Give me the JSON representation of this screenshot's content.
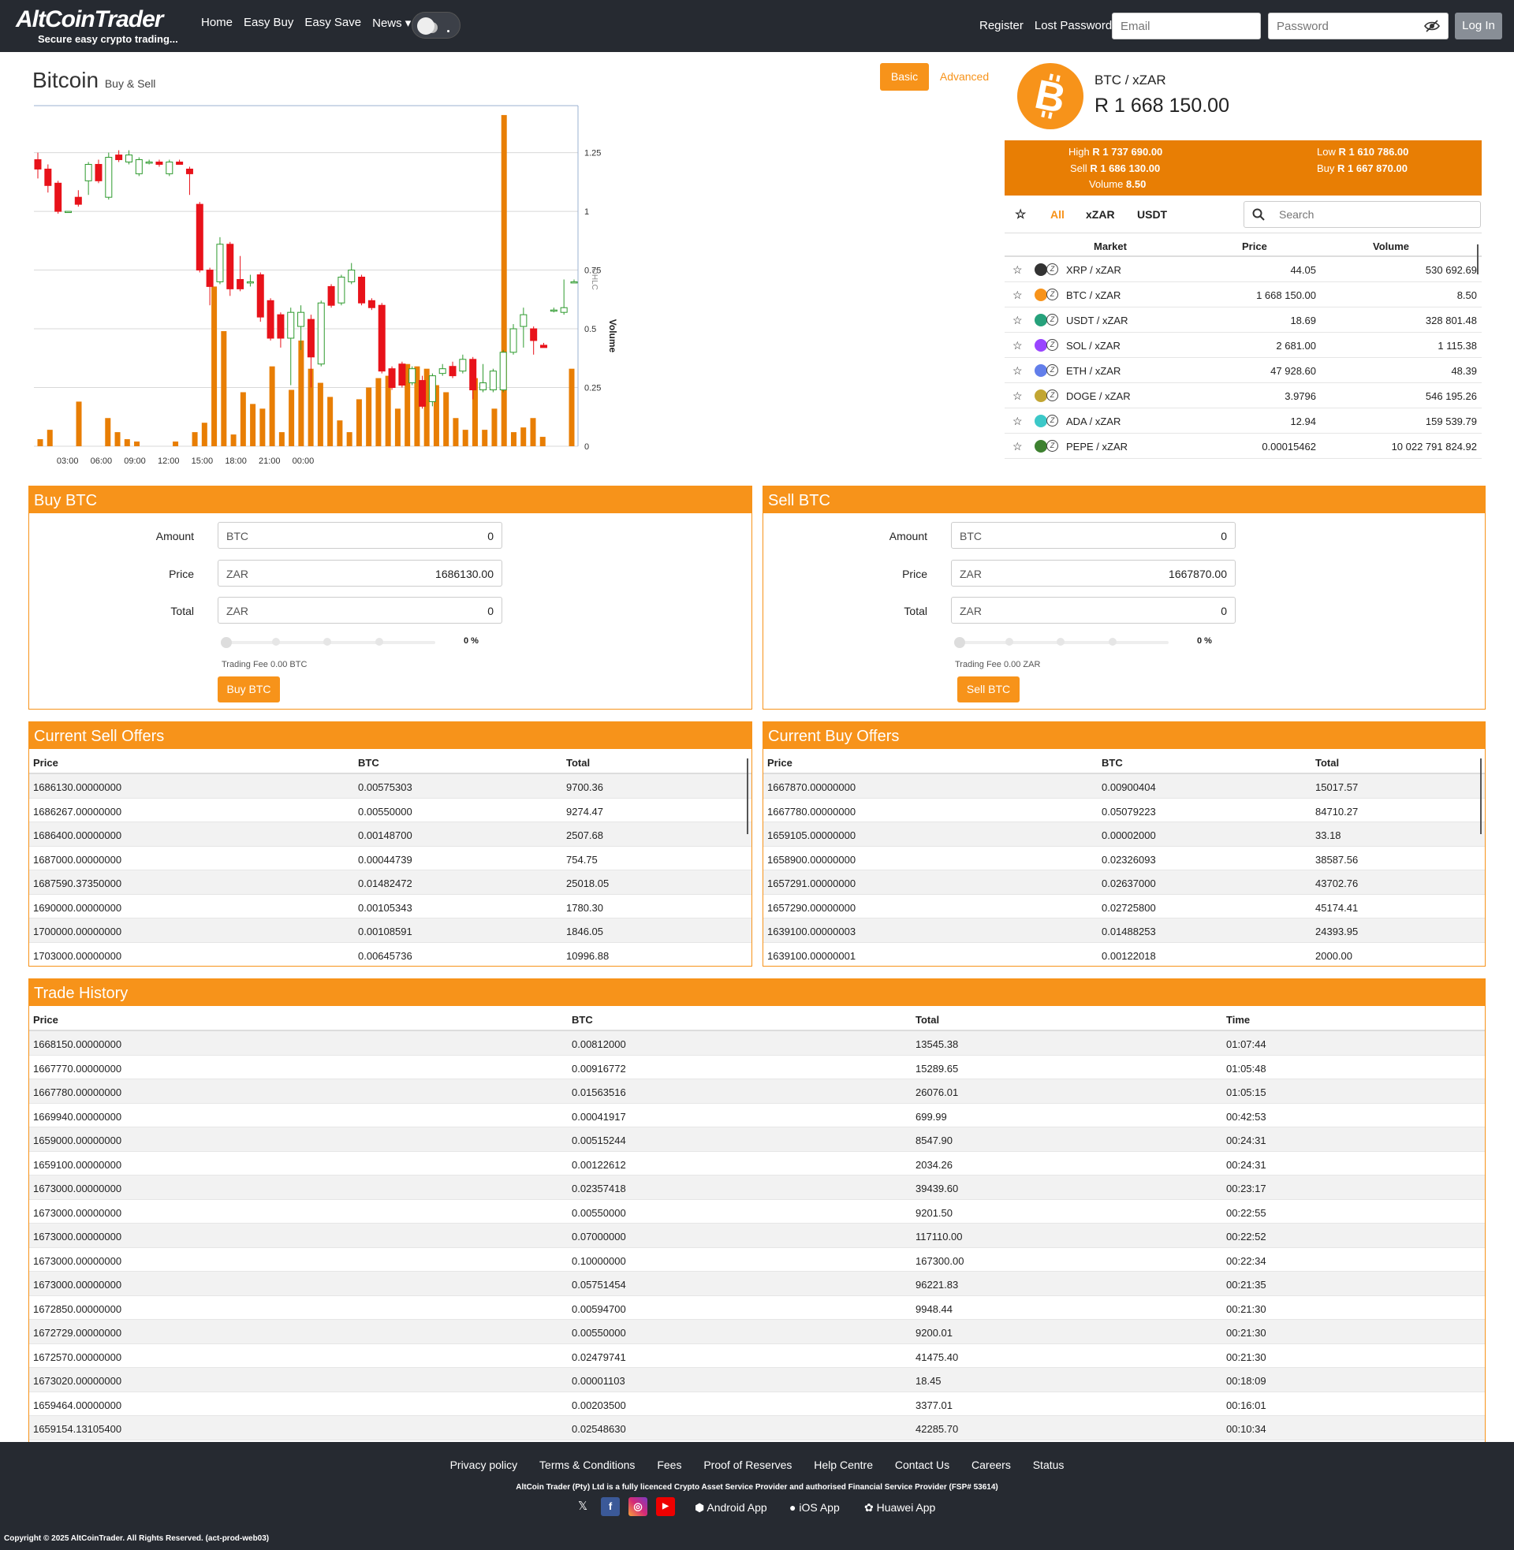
{
  "header": {
    "logo_text": "AltCoinTrader",
    "logo_tagline": "Secure easy crypto trading...",
    "nav": [
      "Home",
      "Easy Buy",
      "Easy Save",
      "News ▾"
    ],
    "register": "Register",
    "lost_password": "Lost Password",
    "email_placeholder": "Email",
    "password_placeholder": "Password",
    "login": "Log In"
  },
  "page": {
    "title": "Bitcoin",
    "subtitle": "Buy & Sell",
    "tab_basic": "Basic",
    "tab_advanced": "Advanced"
  },
  "ticker": {
    "pair": "BTC / xZAR",
    "price": "R 1 668 150.00",
    "high_label": "High",
    "high": "R 1 737 690.00",
    "low_label": "Low",
    "low": "R 1 610 786.00",
    "sell_label": "Sell",
    "sell": "R 1 686 130.00",
    "buy_label": "Buy",
    "buy": "R 1 667 870.00",
    "volume_label": "Volume",
    "volume": "8.50"
  },
  "markets": {
    "tabs": [
      "All",
      "xZAR",
      "USDT"
    ],
    "active_tab": "All",
    "search_placeholder": "Search",
    "headers": {
      "market": "Market",
      "price": "Price",
      "volume": "Volume"
    },
    "rows": [
      {
        "market": "XRP / xZAR",
        "price": "44.05",
        "volume": "530 692.69",
        "color": "#333333"
      },
      {
        "market": "BTC / xZAR",
        "price": "1 668 150.00",
        "volume": "8.50",
        "color": "#f7931a"
      },
      {
        "market": "USDT / xZAR",
        "price": "18.69",
        "volume": "328 801.48",
        "color": "#26a17b"
      },
      {
        "market": "SOL / xZAR",
        "price": "2 681.00",
        "volume": "1 115.38",
        "color": "#9945ff"
      },
      {
        "market": "ETH / xZAR",
        "price": "47 928.60",
        "volume": "48.39",
        "color": "#627eea"
      },
      {
        "market": "DOGE / xZAR",
        "price": "3.9796",
        "volume": "546 195.26",
        "color": "#c2a633"
      },
      {
        "market": "ADA / xZAR",
        "price": "12.94",
        "volume": "159 539.79",
        "color": "#3cc8c8"
      },
      {
        "market": "PEPE / xZAR",
        "price": "0.00015462",
        "volume": "10 022 791 824.92",
        "color": "#3d8130"
      }
    ]
  },
  "buy_form": {
    "title": "Buy BTC",
    "amount_label": "Amount",
    "amount_unit": "BTC",
    "amount": "0",
    "price_label": "Price",
    "price_unit": "ZAR",
    "price": "1686130.00",
    "total_label": "Total",
    "total_unit": "ZAR",
    "total": "0",
    "percent": "0 %",
    "fee": "Trading Fee 0.00 BTC",
    "button": "Buy BTC"
  },
  "sell_form": {
    "title": "Sell BTC",
    "amount_label": "Amount",
    "amount_unit": "BTC",
    "amount": "0",
    "price_label": "Price",
    "price_unit": "ZAR",
    "price": "1667870.00",
    "total_label": "Total",
    "total_unit": "ZAR",
    "total": "0",
    "percent": "0 %",
    "fee": "Trading Fee 0.00 ZAR",
    "button": "Sell BTC"
  },
  "sell_offers": {
    "title": "Current Sell Offers",
    "headers": [
      "Price",
      "BTC",
      "Total"
    ],
    "rows": [
      [
        "1686130.00000000",
        "0.00575303",
        "9700.36"
      ],
      [
        "1686267.00000000",
        "0.00550000",
        "9274.47"
      ],
      [
        "1686400.00000000",
        "0.00148700",
        "2507.68"
      ],
      [
        "1687000.00000000",
        "0.00044739",
        "754.75"
      ],
      [
        "1687590.37350000",
        "0.01482472",
        "25018.05"
      ],
      [
        "1690000.00000000",
        "0.00105343",
        "1780.30"
      ],
      [
        "1700000.00000000",
        "0.00108591",
        "1846.05"
      ],
      [
        "1703000.00000000",
        "0.00645736",
        "10996.88"
      ]
    ]
  },
  "buy_offers": {
    "title": "Current Buy Offers",
    "headers": [
      "Price",
      "BTC",
      "Total"
    ],
    "rows": [
      [
        "1667870.00000000",
        "0.00900404",
        "15017.57"
      ],
      [
        "1667780.00000000",
        "0.05079223",
        "84710.27"
      ],
      [
        "1659105.00000000",
        "0.00002000",
        "33.18"
      ],
      [
        "1658900.00000000",
        "0.02326093",
        "38587.56"
      ],
      [
        "1657291.00000000",
        "0.02637000",
        "43702.76"
      ],
      [
        "1657290.00000000",
        "0.02725800",
        "45174.41"
      ],
      [
        "1639100.00000003",
        "0.01488253",
        "24393.95"
      ],
      [
        "1639100.00000001",
        "0.00122018",
        "2000.00"
      ]
    ]
  },
  "trade_history": {
    "title": "Trade History",
    "headers": [
      "Price",
      "BTC",
      "Total",
      "Time"
    ],
    "rows": [
      [
        "1668150.00000000",
        "0.00812000",
        "13545.38",
        "01:07:44"
      ],
      [
        "1667770.00000000",
        "0.00916772",
        "15289.65",
        "01:05:48"
      ],
      [
        "1667780.00000000",
        "0.01563516",
        "26076.01",
        "01:05:15"
      ],
      [
        "1669940.00000000",
        "0.00041917",
        "699.99",
        "00:42:53"
      ],
      [
        "1659000.00000000",
        "0.00515244",
        "8547.90",
        "00:24:31"
      ],
      [
        "1659100.00000000",
        "0.00122612",
        "2034.26",
        "00:24:31"
      ],
      [
        "1673000.00000000",
        "0.02357418",
        "39439.60",
        "00:23:17"
      ],
      [
        "1673000.00000000",
        "0.00550000",
        "9201.50",
        "00:22:55"
      ],
      [
        "1673000.00000000",
        "0.07000000",
        "117110.00",
        "00:22:52"
      ],
      [
        "1673000.00000000",
        "0.10000000",
        "167300.00",
        "00:22:34"
      ],
      [
        "1673000.00000000",
        "0.05751454",
        "96221.83",
        "00:21:35"
      ],
      [
        "1672850.00000000",
        "0.00594700",
        "9948.44",
        "00:21:30"
      ],
      [
        "1672729.00000000",
        "0.00550000",
        "9200.01",
        "00:21:30"
      ],
      [
        "1672570.00000000",
        "0.02479741",
        "41475.40",
        "00:21:30"
      ],
      [
        "1673020.00000000",
        "0.00001103",
        "18.45",
        "00:18:09"
      ],
      [
        "1659464.00000000",
        "0.00203500",
        "3377.01",
        "00:16:01"
      ],
      [
        "1659154.13105400",
        "0.02548630",
        "42285.70",
        "00:10:34"
      ]
    ]
  },
  "footer": {
    "links": [
      "Privacy policy",
      "Terms & Conditions",
      "Fees",
      "Proof of Reserves",
      "Help Centre",
      "Contact Us",
      "Careers",
      "Status"
    ],
    "legal": "AltCoin Trader (Pty) Ltd is a fully licenced Crypto Asset Service Provider and authorised Financial Service Provider (FSP# 53614)",
    "apps": [
      "Android App",
      "iOS App",
      "Huawei App"
    ],
    "copyright": "Copyright © 2025 AltCoinTrader. All Rights Reserved. (act-prod-web03)"
  },
  "colors": {
    "accent": "#f7931a",
    "dark": "#262a31",
    "up": "#2e9a2e",
    "down": "#e8121a"
  },
  "chart_data": {
    "type": "candlestick",
    "x_ticks": [
      "03:00",
      "06:00",
      "09:00",
      "12:00",
      "15:00",
      "18:00",
      "21:00",
      "00:00"
    ],
    "y_axis_label": "Volume",
    "y_ticks": [
      "0",
      "0.25",
      "0.5",
      "0.75",
      "1",
      "1.25"
    ],
    "ylim": [
      0,
      1.45
    ],
    "ohlc_label": "OHLC",
    "hours": [
      0.5,
      1,
      2,
      3,
      4,
      5,
      6,
      7,
      8,
      9,
      10,
      11,
      12,
      13,
      14,
      15,
      16,
      17,
      18,
      19,
      20,
      21,
      22,
      23,
      24,
      25,
      26,
      27,
      28,
      29,
      30,
      31,
      32,
      33,
      34,
      35,
      36,
      37,
      38,
      39,
      40,
      41,
      42,
      43,
      44,
      45,
      46,
      47,
      48
    ],
    "volume": [
      0.03,
      0.07,
      0.0,
      0.0,
      0.19,
      0.0,
      0.0,
      0.12,
      0.06,
      0.03,
      0.02,
      0.0,
      0.0,
      0.0,
      0.02,
      0.0,
      0.06,
      0.1,
      0.68,
      0.49,
      0.05,
      0.23,
      0.18,
      0.16,
      0.34,
      0.06,
      0.24,
      0.45,
      0.33,
      0.27,
      0.21,
      0.11,
      0.06,
      0.2,
      0.25,
      0.29,
      0.3,
      0.16,
      0.35,
      0.34,
      0.33,
      0.26,
      0.23,
      0.12,
      0.07,
      0.29,
      0.07,
      0.16,
      1.41,
      0.06,
      0.08,
      0.12,
      0.04,
      0.0,
      0.0,
      0.33
    ],
    "candles": [
      {
        "o": 1.22,
        "c": 1.18,
        "h": 1.25,
        "l": 1.14
      },
      {
        "o": 1.18,
        "c": 1.11,
        "h": 1.2,
        "l": 1.08
      },
      {
        "o": 1.12,
        "c": 1.0,
        "h": 1.13,
        "l": 0.99
      },
      {
        "o": 1.0,
        "c": 1.0,
        "h": 1.0,
        "l": 1.0
      },
      {
        "o": 1.06,
        "c": 1.03,
        "h": 1.09,
        "l": 1.02
      },
      {
        "o": 1.13,
        "c": 1.2,
        "h": 1.21,
        "l": 1.07
      },
      {
        "o": 1.2,
        "c": 1.13,
        "h": 1.22,
        "l": 1.12
      },
      {
        "o": 1.06,
        "c": 1.23,
        "h": 1.25,
        "l": 1.05
      },
      {
        "o": 1.24,
        "c": 1.22,
        "h": 1.26,
        "l": 1.21
      },
      {
        "o": 1.21,
        "c": 1.24,
        "h": 1.26,
        "l": 1.2
      },
      {
        "o": 1.16,
        "c": 1.22,
        "h": 1.23,
        "l": 1.15
      },
      {
        "o": 1.21,
        "c": 1.21,
        "h": 1.22,
        "l": 1.2
      },
      {
        "o": 1.21,
        "c": 1.2,
        "h": 1.22,
        "l": 1.19
      },
      {
        "o": 1.16,
        "c": 1.21,
        "h": 1.22,
        "l": 1.15
      },
      {
        "o": 1.21,
        "c": 1.2,
        "h": 1.22,
        "l": 1.2
      },
      {
        "o": 1.18,
        "c": 1.16,
        "h": 1.19,
        "l": 1.07
      },
      {
        "o": 1.03,
        "c": 0.75,
        "h": 1.04,
        "l": 0.74
      },
      {
        "o": 0.75,
        "c": 0.68,
        "h": 0.76,
        "l": 0.6
      },
      {
        "o": 0.7,
        "c": 0.86,
        "h": 0.89,
        "l": 0.69
      },
      {
        "o": 0.86,
        "c": 0.67,
        "h": 0.87,
        "l": 0.64
      },
      {
        "o": 0.71,
        "c": 0.67,
        "h": 0.81,
        "l": 0.66
      },
      {
        "o": 0.7,
        "c": 0.7,
        "h": 0.73,
        "l": 0.68
      },
      {
        "o": 0.73,
        "c": 0.55,
        "h": 0.74,
        "l": 0.53
      },
      {
        "o": 0.62,
        "c": 0.46,
        "h": 0.63,
        "l": 0.45
      },
      {
        "o": 0.56,
        "c": 0.46,
        "h": 0.57,
        "l": 0.42
      },
      {
        "o": 0.46,
        "c": 0.57,
        "h": 0.59,
        "l": 0.26
      },
      {
        "o": 0.51,
        "c": 0.57,
        "h": 0.6,
        "l": 0.41
      },
      {
        "o": 0.54,
        "c": 0.38,
        "h": 0.56,
        "l": 0.25
      },
      {
        "o": 0.35,
        "c": 0.61,
        "h": 0.62,
        "l": 0.34
      },
      {
        "o": 0.68,
        "c": 0.6,
        "h": 0.69,
        "l": 0.59
      },
      {
        "o": 0.61,
        "c": 0.72,
        "h": 0.73,
        "l": 0.6
      },
      {
        "o": 0.7,
        "c": 0.75,
        "h": 0.78,
        "l": 0.69
      },
      {
        "o": 0.72,
        "c": 0.61,
        "h": 0.73,
        "l": 0.6
      },
      {
        "o": 0.62,
        "c": 0.59,
        "h": 0.63,
        "l": 0.58
      },
      {
        "o": 0.6,
        "c": 0.32,
        "h": 0.61,
        "l": 0.31
      },
      {
        "o": 0.33,
        "c": 0.25,
        "h": 0.34,
        "l": 0.24
      },
      {
        "o": 0.35,
        "c": 0.26,
        "h": 0.36,
        "l": 0.25
      },
      {
        "o": 0.27,
        "c": 0.33,
        "h": 0.34,
        "l": 0.26
      },
      {
        "o": 0.28,
        "c": 0.17,
        "h": 0.3,
        "l": 0.16
      },
      {
        "o": 0.19,
        "c": 0.3,
        "h": 0.31,
        "l": 0.17
      },
      {
        "o": 0.31,
        "c": 0.33,
        "h": 0.35,
        "l": 0.3
      },
      {
        "o": 0.34,
        "c": 0.3,
        "h": 0.36,
        "l": 0.29
      },
      {
        "o": 0.32,
        "c": 0.37,
        "h": 0.39,
        "l": 0.31
      },
      {
        "o": 0.37,
        "c": 0.24,
        "h": 0.38,
        "l": 0.2
      },
      {
        "o": 0.24,
        "c": 0.27,
        "h": 0.35,
        "l": 0.23
      },
      {
        "o": 0.24,
        "c": 0.32,
        "h": 0.33,
        "l": 0.23
      },
      {
        "o": 0.24,
        "c": 0.4,
        "h": 0.41,
        "l": 0.23
      },
      {
        "o": 0.4,
        "c": 0.5,
        "h": 0.52,
        "l": 0.39
      },
      {
        "o": 0.51,
        "c": 0.56,
        "h": 0.59,
        "l": 0.42
      },
      {
        "o": 0.5,
        "c": 0.45,
        "h": 0.51,
        "l": 0.39
      },
      {
        "o": 0.43,
        "c": 0.42,
        "h": 0.44,
        "l": 0.42
      },
      {
        "o": 0.58,
        "c": 0.58,
        "h": 0.59,
        "l": 0.57
      },
      {
        "o": 0.57,
        "c": 0.59,
        "h": 0.71,
        "l": 0.56
      },
      {
        "o": 0.7,
        "c": 0.7,
        "h": 0.71,
        "l": 0.7
      }
    ]
  }
}
